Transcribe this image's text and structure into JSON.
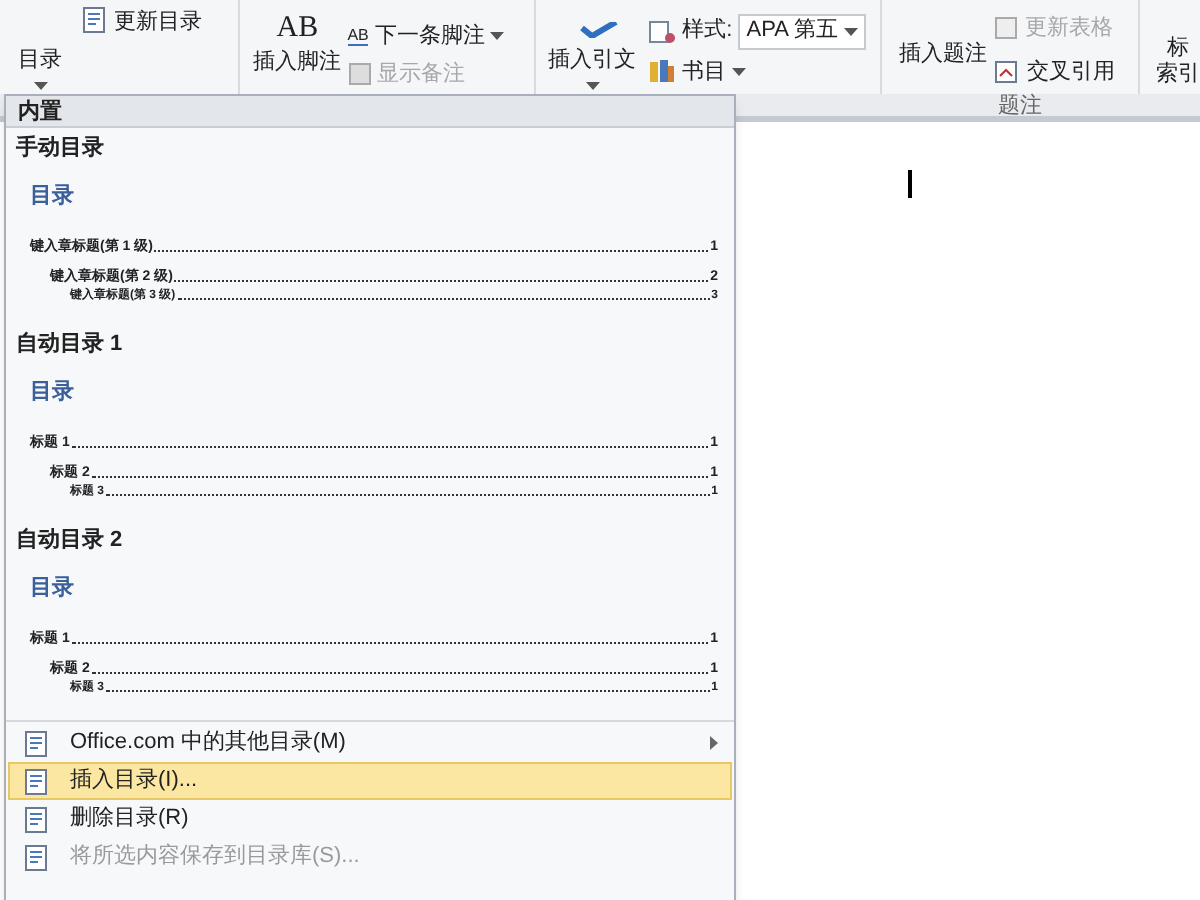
{
  "ribbon": {
    "toc_button": "目录",
    "update_toc": "更新目录",
    "footnote_icon_text": "AB",
    "insert_footnote": "插入脚注",
    "next_footnote_icon_text": "AB",
    "next_footnote": "下一条脚注",
    "show_notes": {
      "label": "显示备注",
      "disabled": true
    },
    "insert_citation": "插入引文",
    "style_label": "样式:",
    "style_value": "APA 第五",
    "bibliography": "书目",
    "insert_caption": "插入题注",
    "update_table": {
      "label": "更新表格",
      "disabled": true
    },
    "cross_reference": "交叉引用",
    "mark_entry_top": "标",
    "mark_entry_bottom": "索引"
  },
  "group_labels": [
    "题注"
  ],
  "menu": {
    "header": "内置",
    "gallery": [
      {
        "title": "手动目录",
        "toc_heading": "目录",
        "entries": [
          {
            "text": "键入章标题(第 1 级)",
            "page": "1",
            "children": [
              {
                "text": "键入章标题(第 2 级)",
                "page": "2",
                "children": [
                  {
                    "text": "键入章标题(第 3 级)",
                    "page": "3"
                  }
                ]
              }
            ]
          }
        ]
      },
      {
        "title": "自动目录 1",
        "toc_heading": "目录",
        "entries": [
          {
            "text": "标题 1",
            "page": "1",
            "children": [
              {
                "text": "标题 2",
                "page": "1",
                "children": [
                  {
                    "text": "标题 3",
                    "page": "1"
                  }
                ]
              }
            ]
          }
        ]
      },
      {
        "title": "自动目录 2",
        "toc_heading": "目录",
        "entries": [
          {
            "text": "标题 1",
            "page": "1",
            "children": [
              {
                "text": "标题 2",
                "page": "1",
                "children": [
                  {
                    "text": "标题 3",
                    "page": "1"
                  }
                ]
              }
            ]
          }
        ]
      }
    ],
    "items": [
      {
        "label": "Office.com 中的其他目录(M)",
        "submenu": true,
        "selected": false,
        "disabled": false
      },
      {
        "label": "插入目录(I)...",
        "submenu": false,
        "selected": true,
        "disabled": false
      },
      {
        "label": "删除目录(R)",
        "submenu": false,
        "selected": false,
        "disabled": false
      },
      {
        "label": "将所选内容保存到目录库(S)...",
        "submenu": false,
        "selected": false,
        "disabled": true
      }
    ]
  }
}
